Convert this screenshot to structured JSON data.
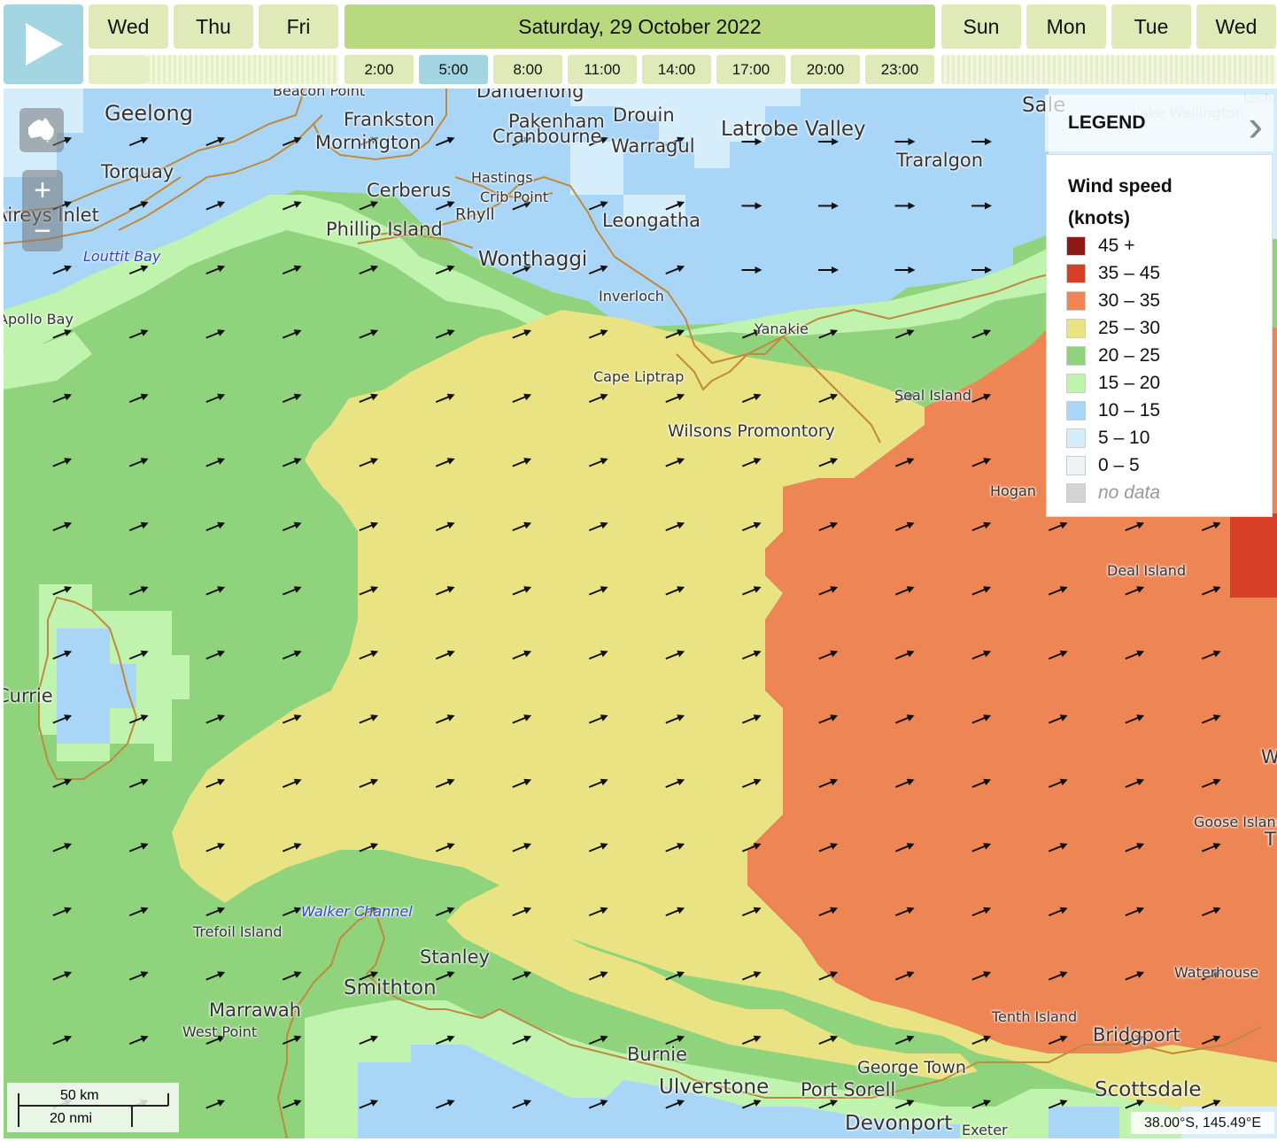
{
  "controls": {
    "play_icon": "play-icon",
    "days_left": [
      "Wed",
      "Thu",
      "Fri"
    ],
    "active_day": "Saturday, 29 October 2022",
    "days_right": [
      "Sun",
      "Mon",
      "Tue",
      "Wed"
    ],
    "hours": [
      "2:00",
      "5:00",
      "8:00",
      "11:00",
      "14:00",
      "17:00",
      "20:00",
      "23:00"
    ],
    "active_hour": "5:00"
  },
  "map": {
    "zoom_in": "+",
    "zoom_out": "−",
    "home_icon": "australia-icon",
    "scale_km": "50 km",
    "scale_nmi": "20 nmi",
    "coordinate": "38.00°S, 145.49°E",
    "labels": [
      {
        "text": "Beacon Point",
        "size": 16
      },
      {
        "text": "Geelong",
        "size": 24
      },
      {
        "text": "Frankston",
        "size": 21
      },
      {
        "text": "Dandenong",
        "size": 21
      },
      {
        "text": "Pakenham",
        "size": 21
      },
      {
        "text": "Drouin",
        "size": 21
      },
      {
        "text": "Cranbourne",
        "size": 21
      },
      {
        "text": "Warragul",
        "size": 21
      },
      {
        "text": "Latrobe Valley",
        "size": 23
      },
      {
        "text": "Traralgon",
        "size": 21
      },
      {
        "text": "Sale",
        "size": 23
      },
      {
        "text": "Mornington",
        "size": 21
      },
      {
        "text": "Torquay",
        "size": 21
      },
      {
        "text": "Hastings",
        "size": 16
      },
      {
        "text": "Crib Point",
        "size": 16
      },
      {
        "text": "Cerberus",
        "size": 21
      },
      {
        "text": "Rhyll",
        "size": 18
      },
      {
        "text": "Leongatha",
        "size": 21
      },
      {
        "text": "Aireys Inlet",
        "size": 21
      },
      {
        "text": "Phillip Island",
        "size": 21
      },
      {
        "text": "Wonthaggi",
        "size": 23
      },
      {
        "text": "Inverloch",
        "size": 16
      },
      {
        "text": "Apollo Bay",
        "size": 16
      },
      {
        "text": "Yanakie",
        "size": 16
      },
      {
        "text": "Cape Liptrap",
        "size": 16
      },
      {
        "text": "Seal Island",
        "size": 16
      },
      {
        "text": "Wilsons Promontory",
        "size": 19
      },
      {
        "text": "Hogan",
        "size": 16
      },
      {
        "text": "Deal Island",
        "size": 16
      },
      {
        "text": "Currie",
        "size": 21
      },
      {
        "text": "Goose Island",
        "size": 16
      },
      {
        "text": "Trefoil Island",
        "size": 16
      },
      {
        "text": "Stanley",
        "size": 21
      },
      {
        "text": "Smithton",
        "size": 23
      },
      {
        "text": "Marrawah",
        "size": 21
      },
      {
        "text": "West Point",
        "size": 16
      },
      {
        "text": "Waterhouse",
        "size": 16
      },
      {
        "text": "Tenth Island",
        "size": 16
      },
      {
        "text": "Bridgport",
        "size": 21
      },
      {
        "text": "Burnie",
        "size": 21
      },
      {
        "text": "George Town",
        "size": 19
      },
      {
        "text": "Ulverstone",
        "size": 23
      },
      {
        "text": "Port Sorell",
        "size": 21
      },
      {
        "text": "Scottsdale",
        "size": 23
      },
      {
        "text": "Devonport",
        "size": 23
      },
      {
        "text": "Exeter",
        "size": 16
      },
      {
        "text": "Lake Wellington",
        "size": 16
      },
      {
        "text": "Loch",
        "size": 14
      },
      {
        "text": "W",
        "size": 21
      },
      {
        "text": "T",
        "size": 21
      }
    ],
    "water_labels": [
      {
        "text": "Louttit Bay",
        "size": 16
      },
      {
        "text": "Walker Channel",
        "size": 16
      }
    ]
  },
  "legend": {
    "header": "LEGEND",
    "title_line1": "Wind speed",
    "title_line2": "(knots)",
    "items": [
      {
        "label": "45 +",
        "color": "#8b1a14"
      },
      {
        "label": "35 – 45",
        "color": "#d63f26"
      },
      {
        "label": "30 – 35",
        "color": "#ee8554"
      },
      {
        "label": "25 – 30",
        "color": "#e9e383"
      },
      {
        "label": "20 – 25",
        "color": "#8fd37c"
      },
      {
        "label": "15 – 20",
        "color": "#c0f4ae"
      },
      {
        "label": "10 – 15",
        "color": "#a9d6f7"
      },
      {
        "label": "5 – 10",
        "color": "#d6edfb"
      },
      {
        "label": "0 – 5",
        "color": "#eef3f8"
      },
      {
        "label": "no data",
        "color": "#d4d4d4"
      }
    ]
  }
}
